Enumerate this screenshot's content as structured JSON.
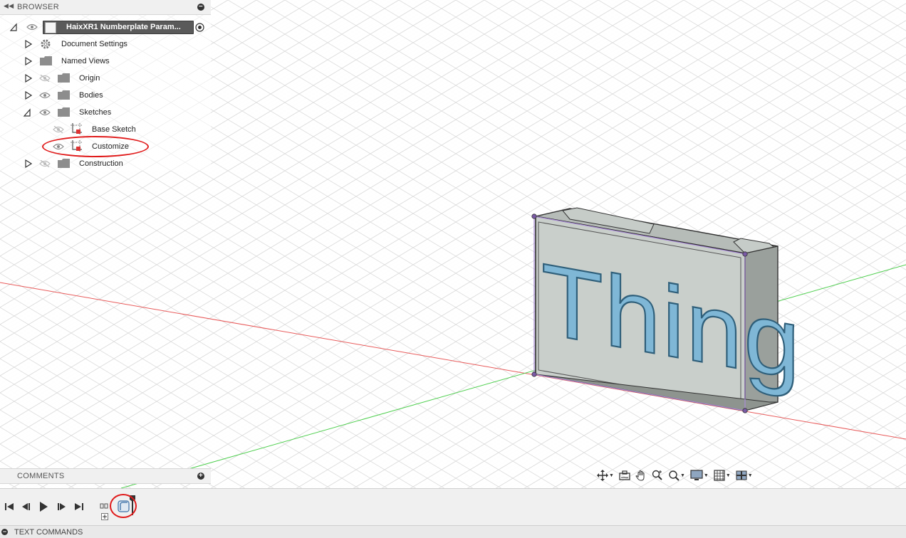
{
  "browser": {
    "header": "BROWSER",
    "root_label": "HaixXR1 Numberplate Param...",
    "items": [
      {
        "label": "Document Settings"
      },
      {
        "label": "Named Views"
      },
      {
        "label": "Origin"
      },
      {
        "label": "Bodies"
      },
      {
        "label": "Sketches"
      },
      {
        "label": "Base Sketch"
      },
      {
        "label": "Customize"
      },
      {
        "label": "Construction"
      }
    ]
  },
  "comments": {
    "header": "COMMENTS"
  },
  "model": {
    "text": "Thing",
    "body_color": "#c9cfcb",
    "text_color": "#7fb7d6"
  },
  "axes": {
    "x_color": "#e85b5b",
    "y_color": "#4fcf4f"
  },
  "text_commands": {
    "header": "TEXT COMMANDS"
  },
  "colors": {
    "highlight_ring": "#e01a1a",
    "selected_row": "#5a5a5a"
  },
  "icons": {
    "navbar": [
      "orbit-icon",
      "look-at-icon",
      "pan-icon",
      "zoom-icon",
      "fit-icon",
      "display-settings-icon",
      "grid-icon",
      "viewports-icon"
    ],
    "timeline": [
      "go-to-start-icon",
      "step-back-icon",
      "play-icon",
      "step-forward-icon",
      "go-to-end-icon"
    ]
  }
}
